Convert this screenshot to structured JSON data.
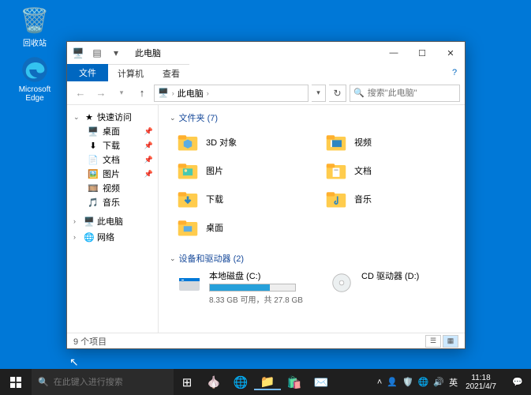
{
  "desktop": {
    "recycle_bin": "回收站",
    "edge": "Microsoft Edge"
  },
  "window": {
    "title": "此电脑",
    "menu": {
      "file": "文件",
      "computer": "计算机",
      "view": "查看"
    },
    "nav_back": "←",
    "nav_fwd": "→",
    "nav_up": "↑",
    "breadcrumb": "此电脑",
    "search_placeholder": "搜索\"此电脑\"",
    "sidebar": {
      "quick_access": "快速访问",
      "items": [
        "桌面",
        "下载",
        "文档",
        "图片",
        "视频",
        "音乐"
      ],
      "this_pc": "此电脑",
      "network": "网络"
    },
    "sections": {
      "folders_head": "文件夹 (7)",
      "folders": [
        "3D 对象",
        "视频",
        "图片",
        "文档",
        "下载",
        "音乐",
        "桌面"
      ],
      "drives_head": "设备和驱动器 (2)",
      "drives": [
        {
          "name": "本地磁盘 (C:)",
          "free": "8.33 GB 可用，共 27.8 GB",
          "used_pct": 70
        },
        {
          "name": "CD 驱动器 (D:)"
        }
      ]
    },
    "status": "9 个项目"
  },
  "taskbar": {
    "search_placeholder": "在此键入进行搜索",
    "ime": "英",
    "time": "11:18",
    "date": "2021/4/7"
  }
}
